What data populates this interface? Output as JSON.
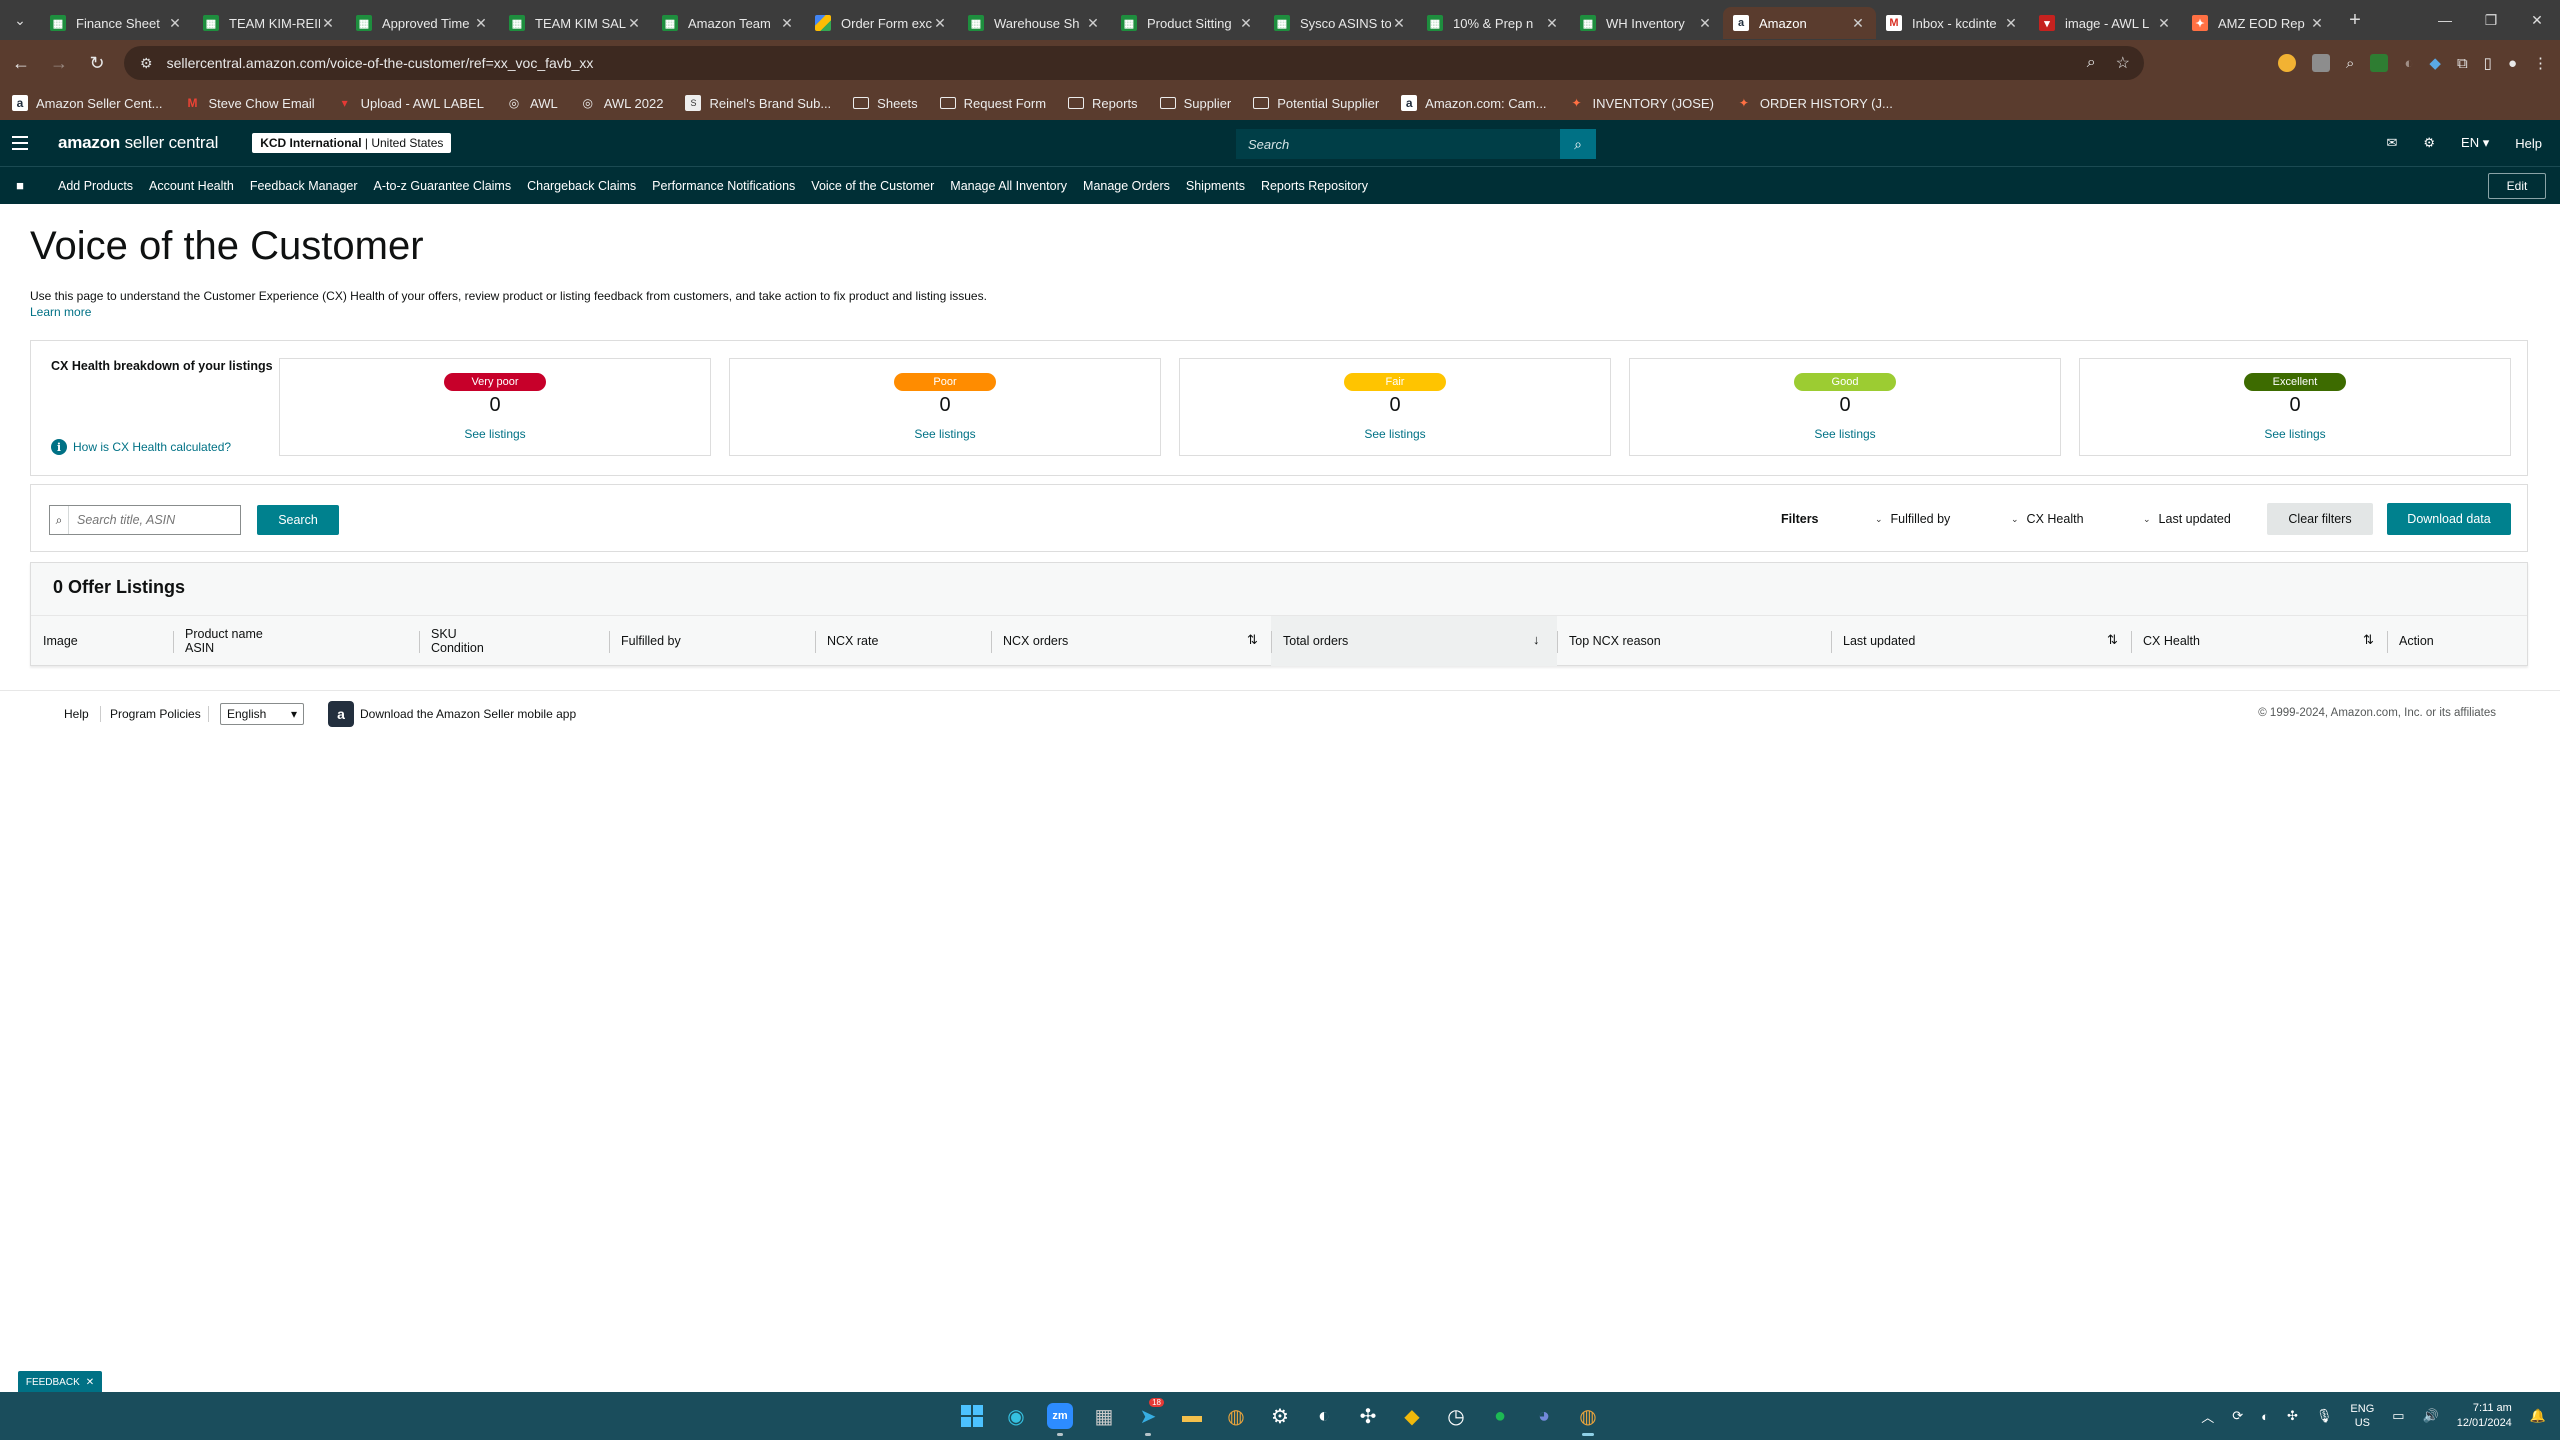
{
  "browser": {
    "tabs": [
      {
        "label": "Finance Sheet",
        "favicon": "sheets-icon"
      },
      {
        "label": "TEAM KIM-REIN",
        "favicon": "sheets-icon"
      },
      {
        "label": "Approved Time",
        "favicon": "sheets-icon"
      },
      {
        "label": "TEAM KIM SAL",
        "favicon": "sheets-icon"
      },
      {
        "label": "Amazon Team",
        "favicon": "sheets-icon"
      },
      {
        "label": "Order Form exc",
        "favicon": "drive-icon"
      },
      {
        "label": "Warehouse Sh",
        "favicon": "sheets-icon"
      },
      {
        "label": "Product Sitting",
        "favicon": "sheets-icon"
      },
      {
        "label": "Sysco ASINS to",
        "favicon": "sheets-icon"
      },
      {
        "label": "10% & Prep n",
        "favicon": "sheets-icon"
      },
      {
        "label": "WH Inventory",
        "favicon": "sheets-icon"
      },
      {
        "label": "Amazon",
        "favicon": "amazon-icon",
        "active": true
      },
      {
        "label": "Inbox - kcdinte",
        "favicon": "gmail-icon"
      },
      {
        "label": "image - AWL L",
        "favicon": "awl-icon"
      },
      {
        "label": "AMZ EOD Rep",
        "favicon": "amz-eod-icon"
      }
    ],
    "url": "sellercentral.amazon.com/voice-of-the-customer/ref=xx_voc_favb_xx",
    "bookmarks": [
      {
        "label": "Amazon Seller Cent...",
        "icon": "amazon-icon"
      },
      {
        "label": "Steve Chow Email",
        "icon": "gmail-icon"
      },
      {
        "label": "Upload - AWL LABEL",
        "icon": "awl-icon"
      },
      {
        "label": "AWL",
        "icon": "globe-icon"
      },
      {
        "label": "AWL 2022",
        "icon": "globe-icon"
      },
      {
        "label": "Reinel's Brand Sub...",
        "icon": "sheet-icon"
      },
      {
        "label": "Sheets",
        "icon": "folder-icon"
      },
      {
        "label": "Request Form",
        "icon": "folder-icon"
      },
      {
        "label": "Reports",
        "icon": "folder-icon"
      },
      {
        "label": "Supplier",
        "icon": "folder-icon"
      },
      {
        "label": "Potential Supplier",
        "icon": "folder-icon"
      },
      {
        "label": "Amazon.com: Cam...",
        "icon": "amazon-icon"
      },
      {
        "label": "INVENTORY (JOSE)",
        "icon": "pinwheel-icon"
      },
      {
        "label": "ORDER HISTORY (J...",
        "icon": "pinwheel-icon"
      }
    ]
  },
  "header": {
    "logo": "amazon",
    "logo_suffix": "seller central",
    "account_name": "KCD International",
    "account_region": "United States",
    "search_placeholder": "Search",
    "language": "EN",
    "help": "Help"
  },
  "nav": {
    "links": [
      "Add Products",
      "Account Health",
      "Feedback Manager",
      "A-to-z Guarantee Claims",
      "Chargeback Claims",
      "Performance Notifications",
      "Voice of the Customer",
      "Manage All Inventory",
      "Manage Orders",
      "Shipments",
      "Reports Repository"
    ],
    "edit": "Edit"
  },
  "page": {
    "title": "Voice of the Customer",
    "intro": "Use this page to understand the Customer Experience (CX) Health of your offers, review product or listing feedback from customers, and take action to fix product and listing issues.",
    "learn_more": "Learn more"
  },
  "cx": {
    "title": "CX Health breakdown of your listings",
    "how_link": "How is CX Health calculated?",
    "cards": [
      {
        "label": "Very poor",
        "count": "0",
        "link": "See listings",
        "color": "#c7002a",
        "text_color": "#ffffff"
      },
      {
        "label": "Poor",
        "count": "0",
        "link": "See listings",
        "color": "#ff8c00",
        "text_color": "#ffffff"
      },
      {
        "label": "Fair",
        "count": "0",
        "link": "See listings",
        "color": "#ffc400",
        "text_color": "#ffffff"
      },
      {
        "label": "Good",
        "count": "0",
        "link": "See listings",
        "color": "#9ccc32",
        "text_color": "#ffffff"
      },
      {
        "label": "Excellent",
        "count": "0",
        "link": "See listings",
        "color": "#3d6b00",
        "text_color": "#ffffff"
      }
    ]
  },
  "filters": {
    "search_placeholder": "Search title, ASIN",
    "search_button": "Search",
    "label": "Filters",
    "fulfilled_by": "Fulfilled by",
    "cx_health": "CX Health",
    "last_updated": "Last updated",
    "clear": "Clear filters",
    "download": "Download data"
  },
  "listings": {
    "title": "0 Offer Listings",
    "columns": {
      "image": "Image",
      "product_name": "Product name",
      "asin": "ASIN",
      "sku": "SKU",
      "condition": "Condition",
      "fulfilled_by": "Fulfilled by",
      "ncx_rate": "NCX rate",
      "ncx_orders": "NCX orders",
      "total_orders": "Total orders",
      "top_ncx_reason": "Top NCX reason",
      "last_updated": "Last updated",
      "cx_health": "CX Health",
      "action": "Action"
    }
  },
  "footer": {
    "help": "Help",
    "policies": "Program Policies",
    "language": "English",
    "app": "Download the Amazon Seller mobile app",
    "copyright": "© 1999-2024, Amazon.com, Inc. or its affiliates"
  },
  "feedback": "FEEDBACK",
  "taskbar": {
    "lang_top": "ENG",
    "lang_bottom": "US",
    "time": "7:11 am",
    "date": "12/01/2024",
    "notification_badge": "18"
  },
  "colors": {
    "brand_dark": "#002f36",
    "accent_teal": "#00818e",
    "link": "#007185",
    "browser_frame": "#5a3c2e"
  }
}
